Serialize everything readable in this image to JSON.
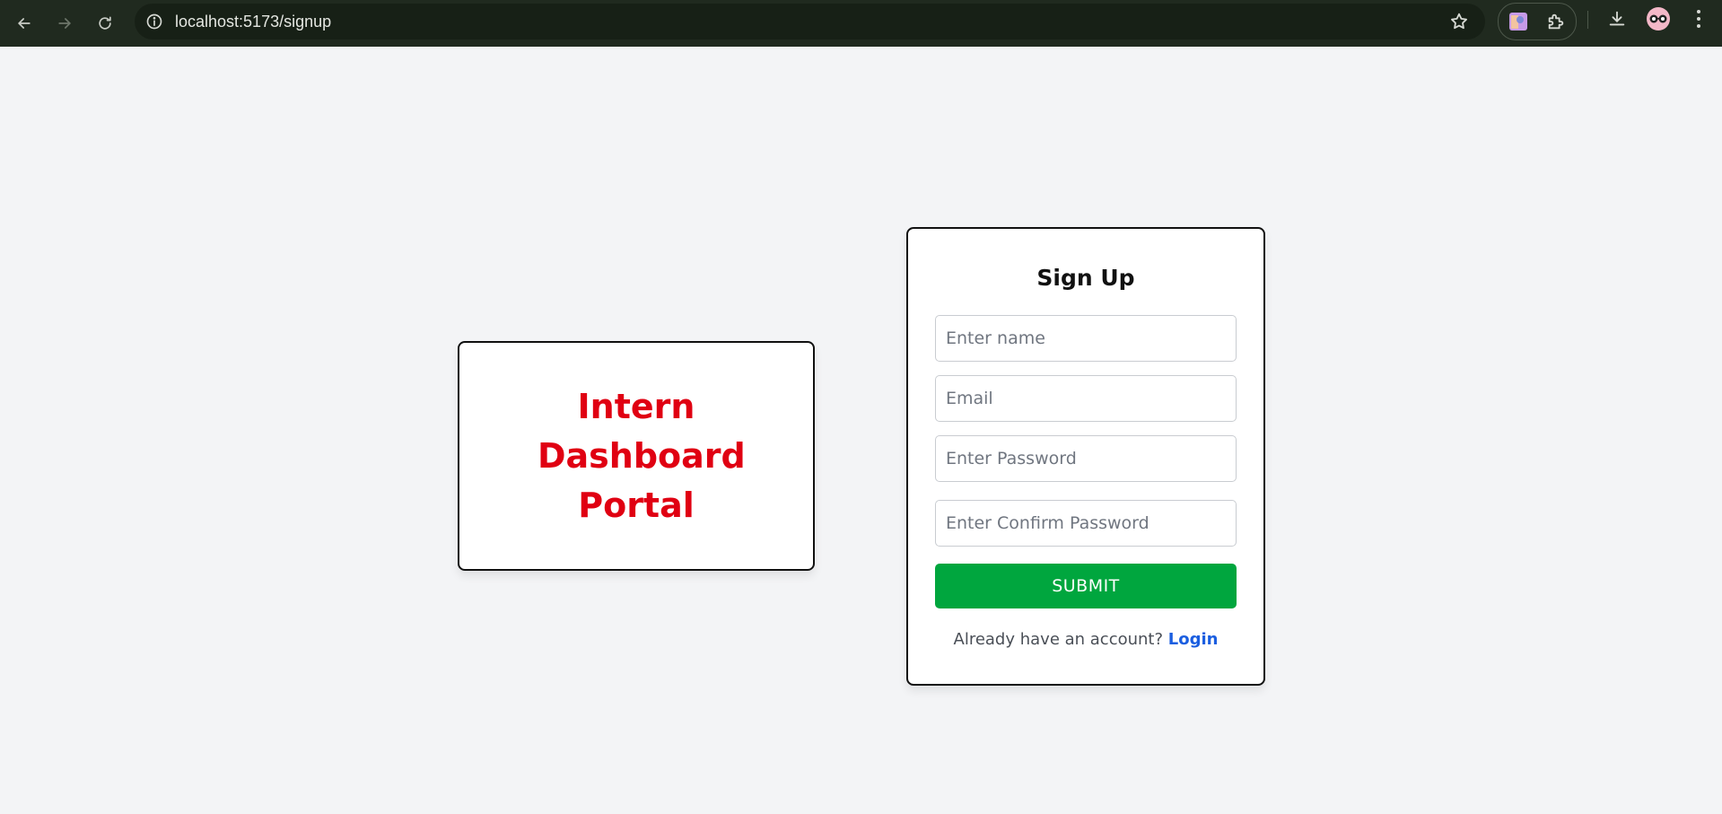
{
  "browser": {
    "url": "localhost:5173/signup",
    "icons": {
      "back": "back-arrow-icon",
      "forward": "forward-arrow-icon",
      "reload": "reload-icon",
      "site_info": "info-icon",
      "bookmark": "star-icon",
      "extension_1": "extension-avatar-icon",
      "extensions": "puzzle-icon",
      "download": "download-icon",
      "profile": "profile-avatar-icon",
      "menu": "kebab-menu-icon"
    }
  },
  "brand": {
    "title": "Intern Dashboard Portal",
    "color": "#e00012"
  },
  "signup": {
    "title": "Sign Up",
    "name_placeholder": "Enter name",
    "email_placeholder": "Email",
    "password_placeholder": "Enter Password",
    "confirm_password_placeholder": "Enter Confirm Password",
    "submit_label": "SUBMIT",
    "login_prompt": "Already have an account?",
    "login_link": "Login",
    "submit_color": "#00a63e",
    "link_color": "#1a5ee0"
  }
}
